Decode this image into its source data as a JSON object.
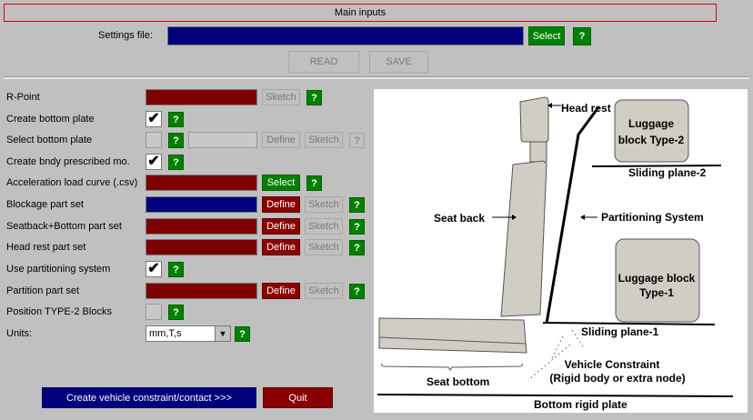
{
  "header": {
    "title": "Main inputs"
  },
  "settings": {
    "label": "Settings file:",
    "select_label": "Select",
    "help": "?"
  },
  "file_actions": {
    "read": "READ",
    "save": "SAVE"
  },
  "rows": {
    "r_point": {
      "label": "R-Point",
      "sketch": "Sketch",
      "help": "?"
    },
    "create_bottom_plate": {
      "label": "Create bottom plate",
      "checked": "✔",
      "help": "?"
    },
    "select_bottom_plate": {
      "label": "Select bottom plate",
      "help": "?",
      "define": "Define",
      "sketch": "Sketch",
      "help2": "?"
    },
    "create_bndy": {
      "label": "Create bndy prescribed mo.",
      "checked": "✔",
      "help": "?"
    },
    "accel_curve": {
      "label": "Acceleration load curve (.csv)",
      "select": "Select",
      "help": "?"
    },
    "blockage": {
      "label": "Blockage part set",
      "define": "Define",
      "sketch": "Sketch",
      "help": "?"
    },
    "seatback_bottom": {
      "label": "Seatback+Bottom part set",
      "define": "Define",
      "sketch": "Sketch",
      "help": "?"
    },
    "head_rest": {
      "label": "Head rest part set",
      "define": "Define",
      "sketch": "Sketch",
      "help": "?"
    },
    "use_partitioning": {
      "label": "Use partitioning system",
      "checked": "✔",
      "help": "?"
    },
    "partition_set": {
      "label": "Partition part set",
      "define": "Define",
      "sketch": "Sketch",
      "help": "?"
    },
    "type2_blocks": {
      "label": "Position TYPE-2 Blocks",
      "help": "?"
    },
    "units": {
      "label": "Units:",
      "value": "mm,T,s",
      "help": "?"
    }
  },
  "footer": {
    "create": "Create vehicle constraint/contact >>>",
    "quit": "Quit"
  },
  "diagram": {
    "head_rest": "Head rest",
    "luggage2_line1": "Luggage",
    "luggage2_line2": "block Type-2",
    "sliding2": "Sliding plane-2",
    "seat_back": "Seat back",
    "partitioning": "Partitioning System",
    "luggage1_line1": "Luggage block",
    "luggage1_line2": "Type-1",
    "sliding1": "Sliding plane-1",
    "vehicle_line1": "Vehicle Constraint",
    "vehicle_line2": "(Rigid body or extra node)",
    "seat_bottom": "Seat bottom",
    "bottom_plate": "Bottom rigid plate"
  },
  "colors": {
    "dark_red": "#7d0000",
    "dark_blue": "#00007d",
    "green": "#008000",
    "panel": "#c0c0c0"
  }
}
